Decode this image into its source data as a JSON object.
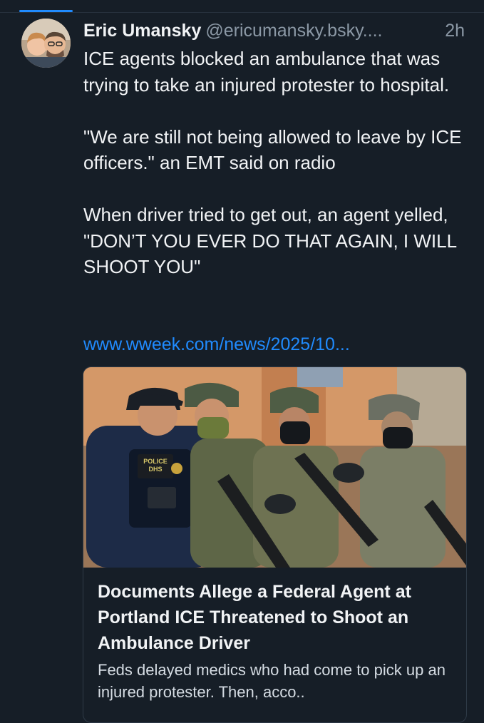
{
  "post": {
    "author": "Eric Umansky",
    "handle": "@ericumansky.bsky....",
    "time": "2h",
    "text": "ICE agents blocked an ambulance that was trying to take an injured protester to hospital.\n\n\"We are still not being allowed to leave by ICE officers.\" an EMT said on radio\n\nWhen driver tried to get out, an agent yelled, \"DON’T YOU EVER DO THAT AGAIN, I WILL SHOOT YOU\"",
    "link": "www.wweek.com/news/2025/10..."
  },
  "card": {
    "title": "Documents Allege a Federal Agent at Portland ICE Threatened to Shoot an Ambulance Driver",
    "description": "Feds delayed medics who had come to pick up an injured protester. Then, acco..",
    "image_patch_line1": "POLICE",
    "image_patch_line2": "DHS"
  },
  "colors": {
    "background": "#161e27",
    "text": "#f1f3f5",
    "muted": "#8b98a5",
    "link": "#208bfe",
    "border": "#2e3a47"
  }
}
